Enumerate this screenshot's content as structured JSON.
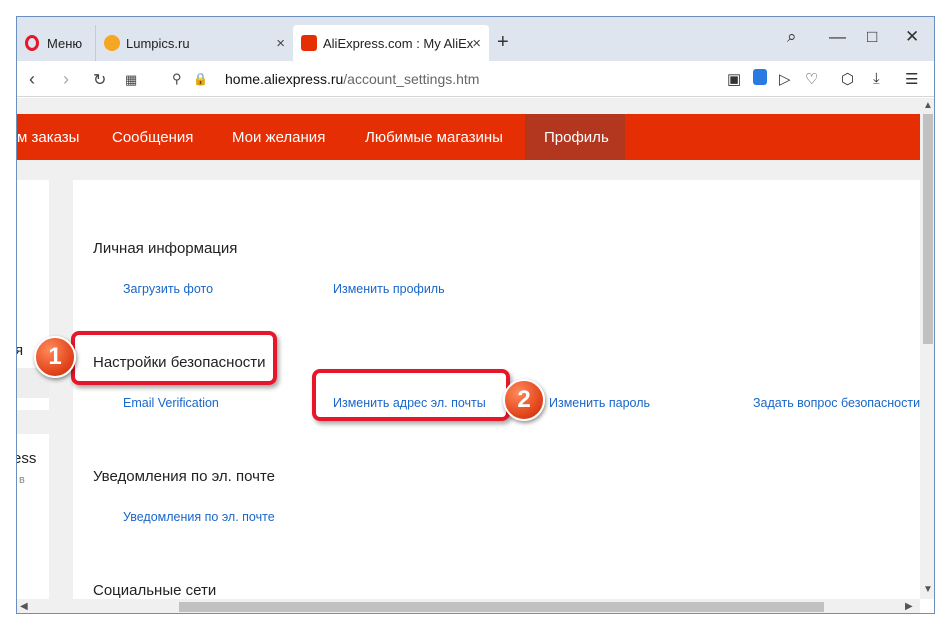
{
  "browser": {
    "menu_label": "Меню",
    "tabs": [
      {
        "title": "Lumpics.ru",
        "close": "×"
      },
      {
        "title": "AliExpress.com : My AliExp",
        "close": "×"
      }
    ],
    "new_tab": "+",
    "url_domain": "home.aliexpress.ru",
    "url_path": "/account_settings.htm"
  },
  "nav_menu": {
    "items": [
      "м заказы",
      "Сообщения",
      "Мои желания",
      "Любимые магазины",
      "Профиль"
    ]
  },
  "left_fragments": [
    "я",
    "ess",
    "в"
  ],
  "sections": [
    {
      "title": "Личная информация",
      "links": [
        "Загрузить фото",
        "Изменить профиль"
      ]
    },
    {
      "title": "Настройки безопасности",
      "links": [
        "Email Verification",
        "Изменить адрес эл. почты",
        "Изменить пароль",
        "Задать вопрос безопасности"
      ]
    },
    {
      "title": "Уведомления по эл. почте",
      "links": [
        "Уведомления по эл. почте"
      ]
    },
    {
      "title": "Социальные сети",
      "links": []
    }
  ],
  "annotations": [
    "1",
    "2"
  ],
  "colors": {
    "accent": "#e62e04",
    "link": "#1a66c9",
    "callout": "#e8162a"
  }
}
